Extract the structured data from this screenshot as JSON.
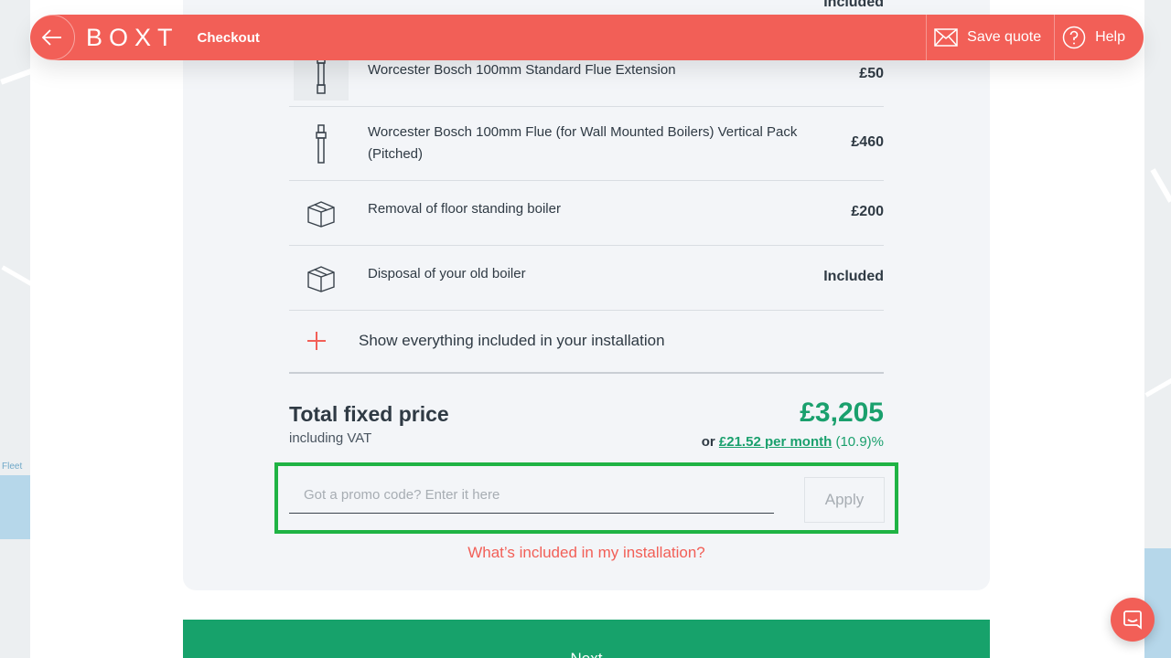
{
  "header": {
    "logo": "BOXT",
    "title": "Checkout",
    "save_quote": "Save quote",
    "help": "Help"
  },
  "items": [
    {
      "name": "Worcester Bosch 100mm Standard Flue Extension",
      "price": "£50",
      "icon": "flue-extension-icon"
    },
    {
      "name": "Worcester Bosch 100mm Flue (for Wall Mounted Boilers) Vertical Pack (Pitched)",
      "price": "£460",
      "icon": "vertical-flue-icon"
    },
    {
      "name": "Removal of floor standing boiler",
      "price": "£200",
      "icon": "box-icon"
    },
    {
      "name": "Disposal of your old boiler",
      "price": "Included",
      "icon": "box-icon"
    }
  ],
  "top_item_price": "Included",
  "show_all": "Show everything included in your installation",
  "total": {
    "label": "Total fixed price",
    "sub": "including VAT",
    "price": "£3,205",
    "or": "or",
    "monthly": "£21.52 per month",
    "apr": "(10.9)%"
  },
  "promo": {
    "placeholder": "Got a promo code? Enter it here",
    "apply": "Apply"
  },
  "whats_included": "What’s included in my installation?",
  "next": "Next",
  "colors": {
    "brand": "#f25f57",
    "green": "#17a26b",
    "highlight": "#1fb344"
  }
}
